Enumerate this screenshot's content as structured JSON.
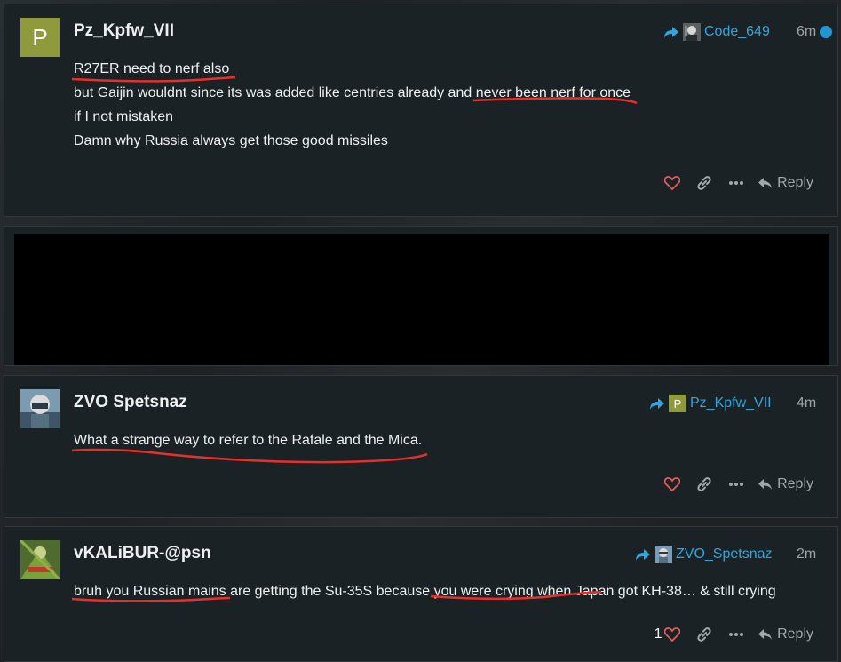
{
  "posts": [
    {
      "username": "Pz_Kpfw_VII",
      "avatar_letter": "P",
      "reply_to": "Code_649",
      "time": "6m",
      "lines": [
        "R27ER need to nerf also",
        "but Gaijin wouldnt since its was added like centries already and never been nerf for once",
        "if I not mistaken",
        "Damn why Russia always get those good missiles"
      ],
      "reply_label": "Reply"
    },
    {
      "username": "ZVO Spetsnaz",
      "reply_to": "Pz_Kpfw_VII",
      "reply_to_letter": "P",
      "time": "4m",
      "lines": [
        "What a strange way to refer to the Rafale and the Mica."
      ],
      "reply_label": "Reply"
    },
    {
      "username": "vKALiBUR-@psn",
      "reply_to": "ZVO_Spetsnaz",
      "time": "2m",
      "lines": [
        "bruh you Russian mains are getting the Su-35S because you were crying when Japan got KH-38… & still crying"
      ],
      "like_count": "1",
      "reply_label": "Reply"
    }
  ],
  "colors": {
    "accent_link": "#2fa6e0",
    "unread_dot": "#2196d1",
    "avatar_p": "#8f9a3c",
    "like_heart": "#e45c5c",
    "annotation_red": "#e8302a"
  },
  "icons": [
    "reply-arrow-icon",
    "heart-icon",
    "link-icon",
    "more-icon",
    "reply-icon"
  ]
}
